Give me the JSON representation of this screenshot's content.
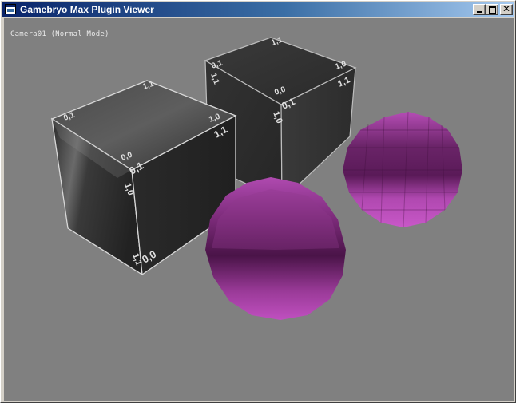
{
  "window": {
    "title": "Gamebryo Max Plugin Viewer",
    "buttons": {
      "minimize": "_",
      "maximize": "□",
      "close": "✕"
    }
  },
  "viewport": {
    "background": "#808080",
    "camera_label": "Camera01 (Normal Mode)"
  },
  "scene": {
    "cube_uv_labels": {
      "front_cube": {
        "top_back_left": "0,1",
        "top_right": "1,1",
        "top_front_right": "1,0",
        "top_front": "0,0",
        "front_top_left": "0,1",
        "front_top_right": "1,1",
        "front_bottom_left": "0,0",
        "side_top": "1,0",
        "side_bottom": "1,1"
      },
      "back_cube": {
        "top_left": "0,1",
        "top_far": "1,1",
        "top_right": "1,0",
        "top_front": "0,0",
        "front_top_left": "0,1",
        "front_top_right": "1,1",
        "side_top": "1,1",
        "side_mid": "1,0"
      }
    },
    "sphere_color": "#b040b0"
  }
}
